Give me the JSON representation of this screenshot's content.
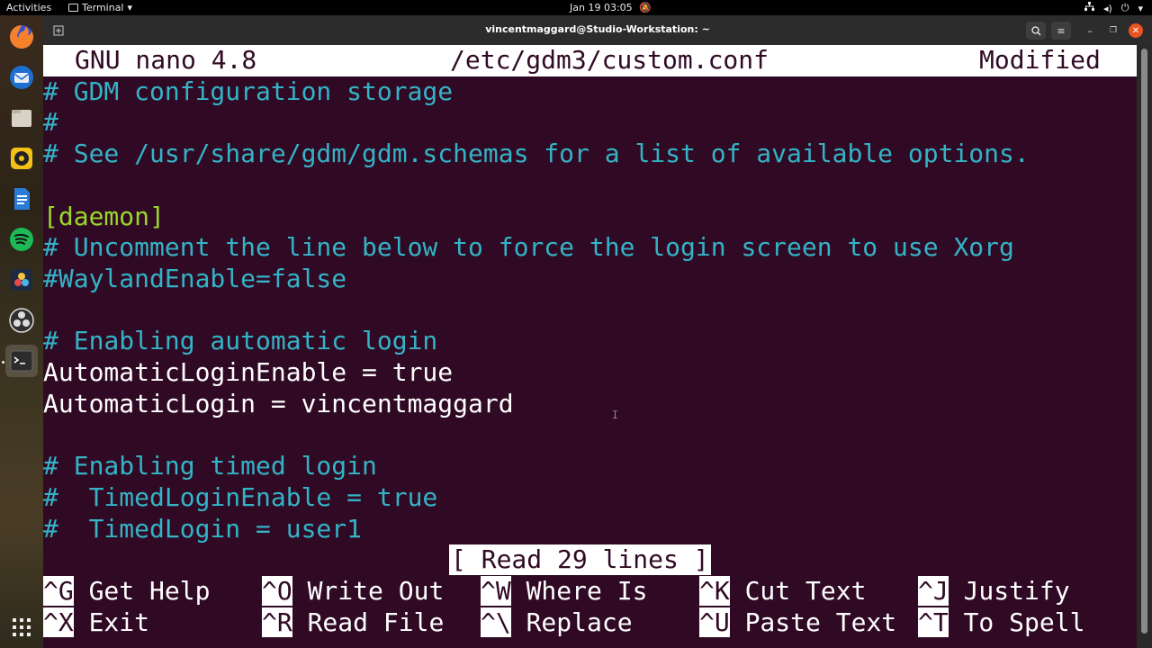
{
  "topbar": {
    "activities": "Activities",
    "app_name": "Terminal",
    "clock": "Jan 19  03:05"
  },
  "window": {
    "title": "vincentmaggard@Studio-Workstation: ~"
  },
  "nano": {
    "version": "GNU nano 4.8",
    "filename": "/etc/gdm3/custom.conf",
    "state": "Modified",
    "lines": [
      {
        "text": "# GDM configuration storage",
        "style": "comment"
      },
      {
        "text": "#",
        "style": "comment"
      },
      {
        "text": "# See /usr/share/gdm/gdm.schemas for a list of available options.",
        "style": "comment"
      },
      {
        "text": "",
        "style": "plain"
      },
      {
        "text": "[daemon]",
        "style": "section"
      },
      {
        "text": "# Uncomment the line below to force the login screen to use Xorg",
        "style": "comment"
      },
      {
        "text": "#WaylandEnable=false",
        "style": "comment"
      },
      {
        "text": "",
        "style": "plain"
      },
      {
        "text": "# Enabling automatic login",
        "style": "comment"
      },
      {
        "text": "AutomaticLoginEnable = true",
        "style": "plain"
      },
      {
        "text": "AutomaticLogin = vincentmaggard",
        "style": "plain"
      },
      {
        "text": "",
        "style": "plain"
      },
      {
        "text": "# Enabling timed login",
        "style": "comment"
      },
      {
        "text": "#  TimedLoginEnable = true",
        "style": "comment"
      },
      {
        "text": "#  TimedLogin = user1",
        "style": "comment"
      }
    ],
    "status_message": "[ Read 29 lines ]",
    "shortcuts_row1": [
      {
        "key": "^G",
        "label": "Get Help"
      },
      {
        "key": "^O",
        "label": "Write Out"
      },
      {
        "key": "^W",
        "label": "Where Is"
      },
      {
        "key": "^K",
        "label": "Cut Text"
      },
      {
        "key": "^J",
        "label": "Justify"
      }
    ],
    "shortcuts_row2": [
      {
        "key": "^X",
        "label": "Exit"
      },
      {
        "key": "^R",
        "label": "Read File"
      },
      {
        "key": "^\\",
        "label": "Replace"
      },
      {
        "key": "^U",
        "label": "Paste Text"
      },
      {
        "key": "^T",
        "label": "To Spell"
      }
    ]
  },
  "dock": {
    "apps": [
      {
        "icon": "firefox-icon"
      },
      {
        "icon": "thunderbird-icon"
      },
      {
        "icon": "files-icon"
      },
      {
        "icon": "rhythmbox-icon"
      },
      {
        "icon": "libreoffice-writer-icon"
      },
      {
        "icon": "spotify-icon"
      },
      {
        "icon": "davinci-resolve-icon"
      },
      {
        "icon": "obs-studio-icon"
      },
      {
        "icon": "terminal-icon"
      }
    ],
    "show_apps_icon": "show-applications-icon"
  },
  "colors": {
    "terminal_bg": "#300a24",
    "comment": "#34b3c6",
    "section": "#9bd72a",
    "text": "#ffffff"
  }
}
